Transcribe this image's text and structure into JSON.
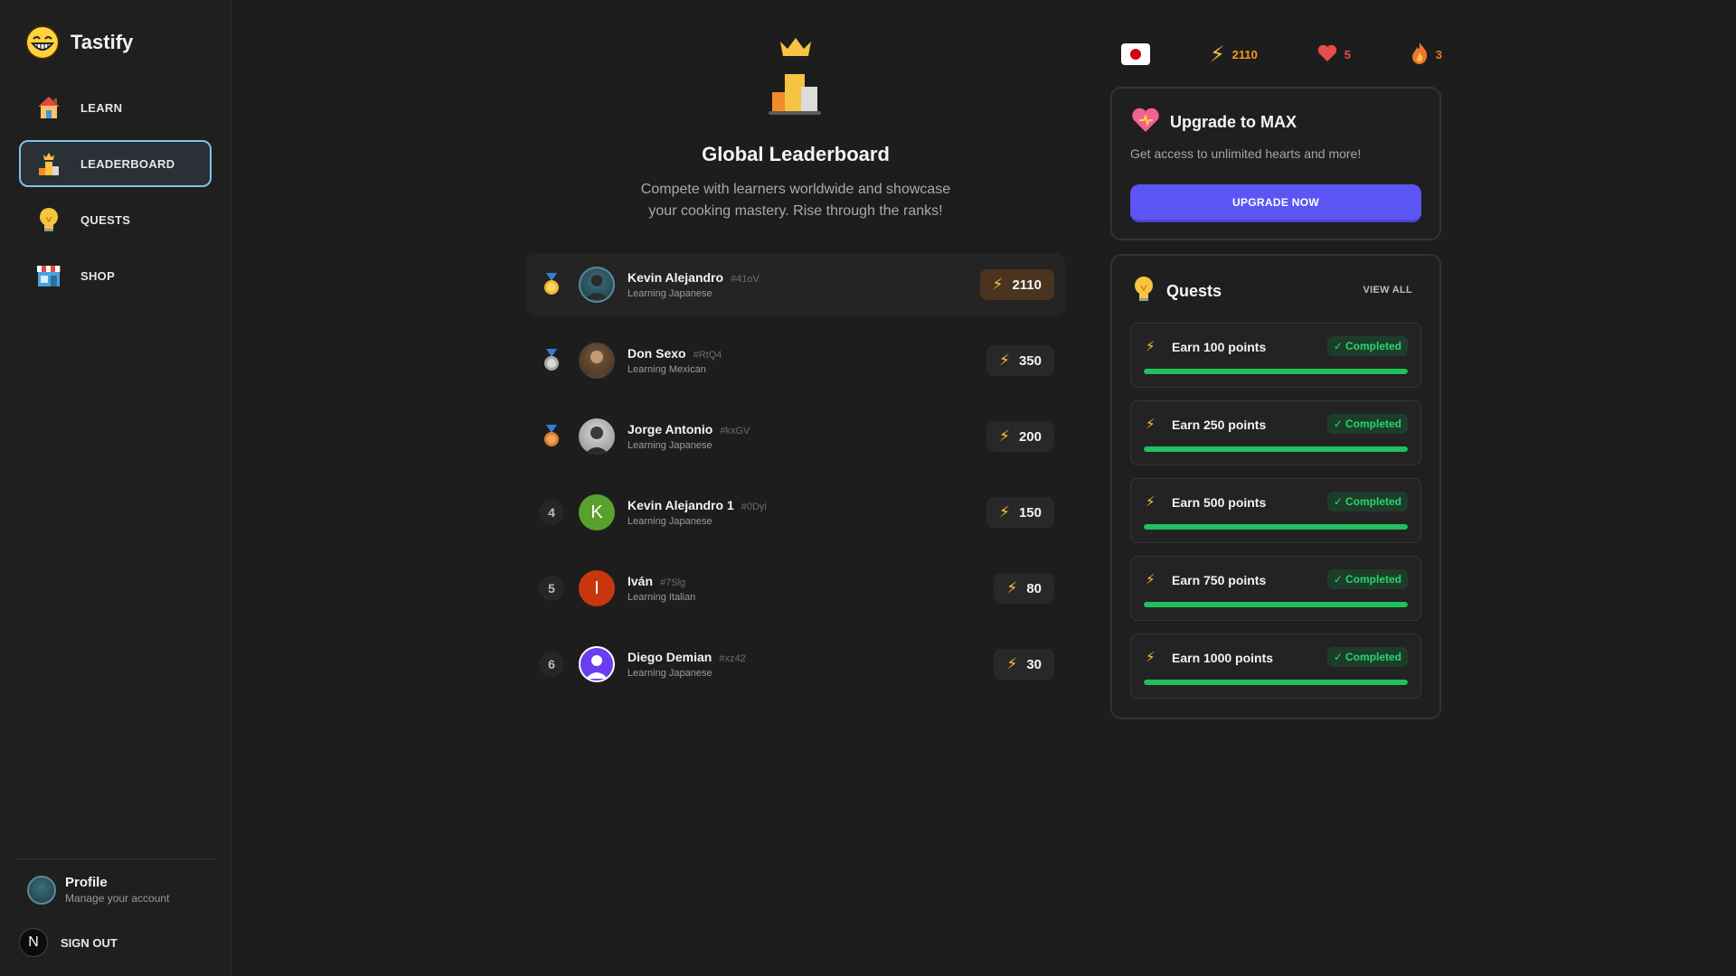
{
  "app": {
    "name": "Tastify"
  },
  "sidebar": {
    "items": [
      {
        "label": "LEARN",
        "icon": "house-icon"
      },
      {
        "label": "LEADERBOARD",
        "icon": "podium-icon",
        "active": true
      },
      {
        "label": "QUESTS",
        "icon": "lightbulb-icon"
      },
      {
        "label": "SHOP",
        "icon": "store-icon"
      }
    ],
    "profile": {
      "title": "Profile",
      "subtitle": "Manage your account"
    },
    "signout": {
      "badge": "N",
      "label": "SIGN OUT"
    }
  },
  "leaderboard": {
    "title": "Global Leaderboard",
    "description_line1": "Compete with learners worldwide and showcase",
    "description_line2": "your cooking mastery. Rise through the ranks!",
    "rows": [
      {
        "rank": "1",
        "medal": "gold",
        "name": "Kevin Alejandro",
        "tag": "#41oV",
        "language": "Learning Japanese",
        "points": "2110",
        "avatar": "photo"
      },
      {
        "rank": "2",
        "medal": "silver",
        "name": "Don Sexo",
        "tag": "#RtQ4",
        "language": "Learning Mexican",
        "points": "350",
        "avatar": "photo"
      },
      {
        "rank": "3",
        "medal": "bronze",
        "name": "Jorge Antonio",
        "tag": "#kxGV",
        "language": "Learning Japanese",
        "points": "200",
        "avatar": "photo"
      },
      {
        "rank": "4",
        "name": "Kevin Alejandro 1",
        "tag": "#0Dyi",
        "language": "Learning Japanese",
        "points": "150",
        "avatar_letter": "K",
        "avatar_color": "#5aa02c"
      },
      {
        "rank": "5",
        "name": "Iván",
        "tag": "#7Slg",
        "language": "Learning Italian",
        "points": "80",
        "avatar_letter": "I",
        "avatar_color": "#c9360d"
      },
      {
        "rank": "6",
        "name": "Diego Demian",
        "tag": "#xz42",
        "language": "Learning Japanese",
        "points": "30",
        "avatar": "user-icon",
        "avatar_color": "#6b3df0"
      }
    ]
  },
  "stats": {
    "flag": "japan-flag-icon",
    "points": "2110",
    "hearts": "5",
    "streak": "3",
    "points_color": "#f39c12",
    "hearts_color": "#e84b4b",
    "streak_color": "#f0762b"
  },
  "upgrade": {
    "title": "Upgrade to MAX",
    "description": "Get access to unlimited hearts and more!",
    "button": "UPGRADE NOW",
    "button_color": "#5b55f5"
  },
  "quests": {
    "title": "Quests",
    "view_all": "VIEW ALL",
    "items": [
      {
        "label": "Earn 100 points",
        "status": "Completed",
        "progress": 1.0
      },
      {
        "label": "Earn 250 points",
        "status": "Completed",
        "progress": 1.0
      },
      {
        "label": "Earn 500 points",
        "status": "Completed",
        "progress": 1.0
      },
      {
        "label": "Earn 750 points",
        "status": "Completed",
        "progress": 1.0
      },
      {
        "label": "Earn 1000 points",
        "status": "Completed",
        "progress": 1.0
      }
    ]
  },
  "colors": {
    "accent": "#5b55f5",
    "success": "#1fc15c",
    "active_border": "#7fc3e6"
  }
}
